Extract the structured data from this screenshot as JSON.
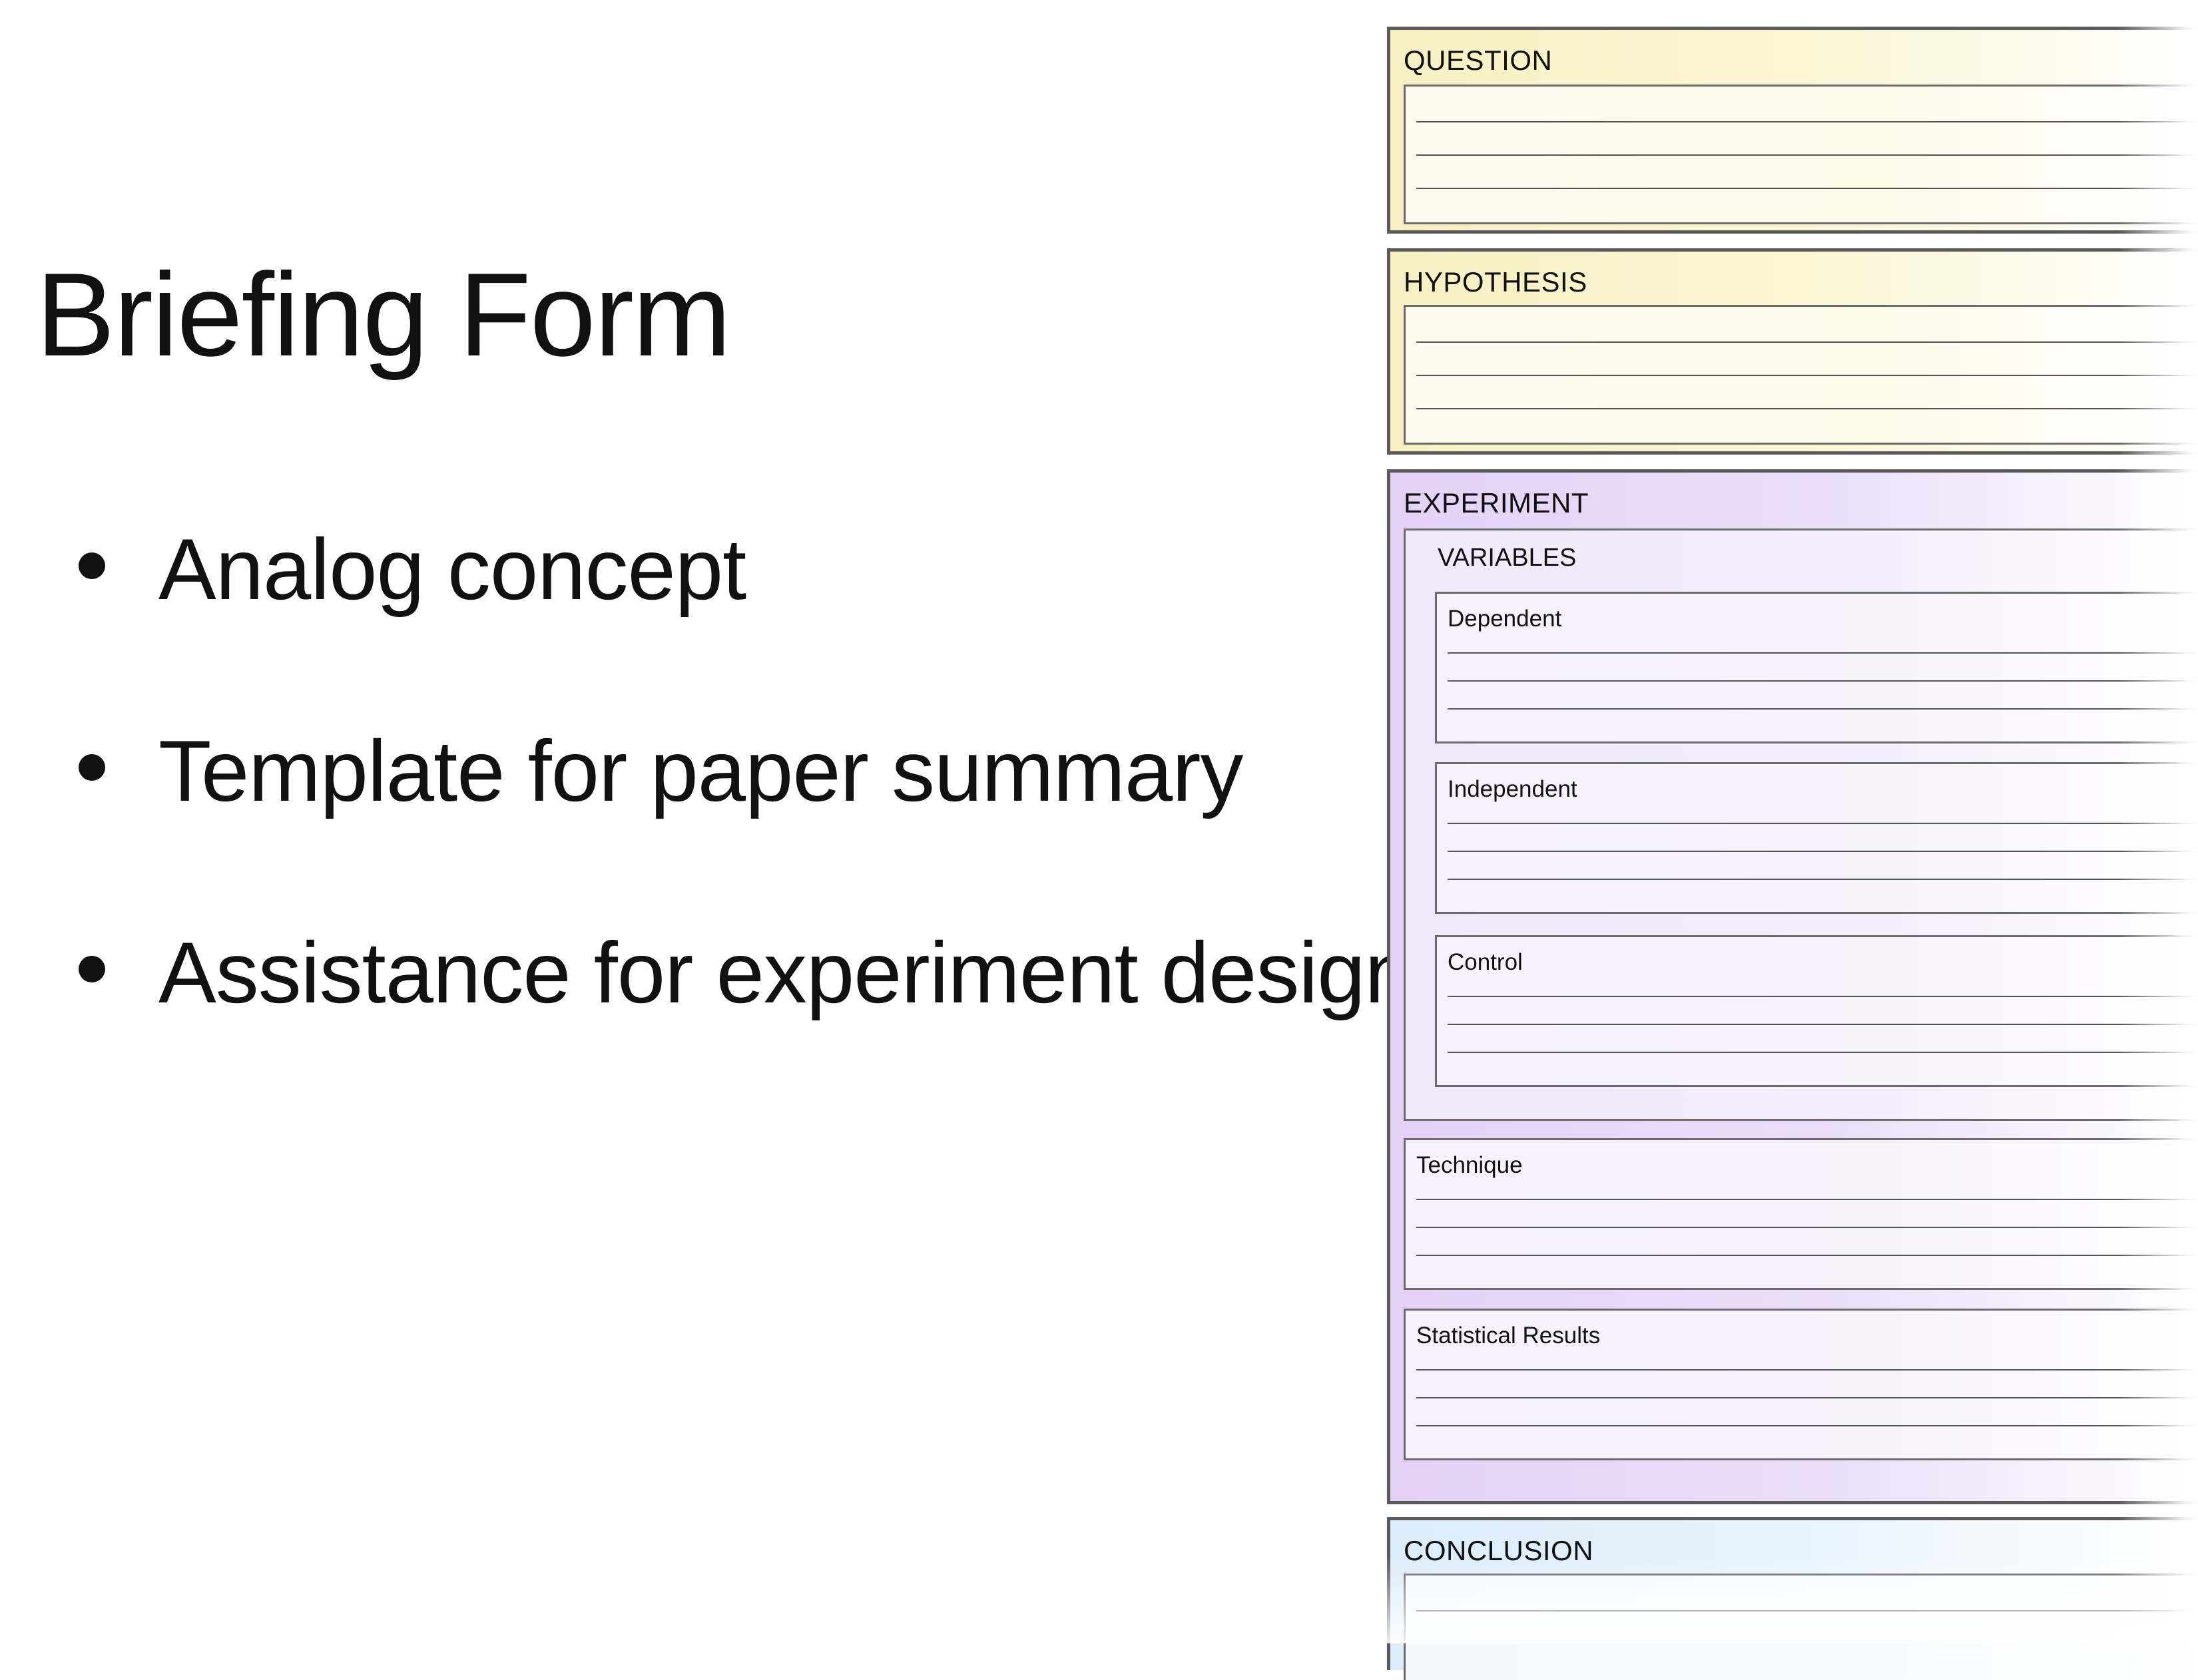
{
  "slide": {
    "title": "Briefing Form",
    "bullets": [
      "Analog concept",
      "Template for paper summary",
      "Assistance for experiment design"
    ]
  },
  "form": {
    "question": {
      "title": "QUESTION"
    },
    "hypothesis": {
      "title": "HYPOTHESIS"
    },
    "experiment": {
      "title": "EXPERIMENT",
      "variables": {
        "title": "VARIABLES",
        "dependent": "Dependent",
        "independent": "Independent",
        "control": "Control"
      },
      "technique": "Technique",
      "statistical_results": "Statistical Results"
    },
    "conclusion": {
      "title": "CONCLUSION"
    }
  },
  "colors": {
    "question_fill": "#f8f0c4",
    "experiment_fill": "#e3d2f6",
    "conclusion_fill": "#dcecfa",
    "border": "#5b5b5b"
  }
}
